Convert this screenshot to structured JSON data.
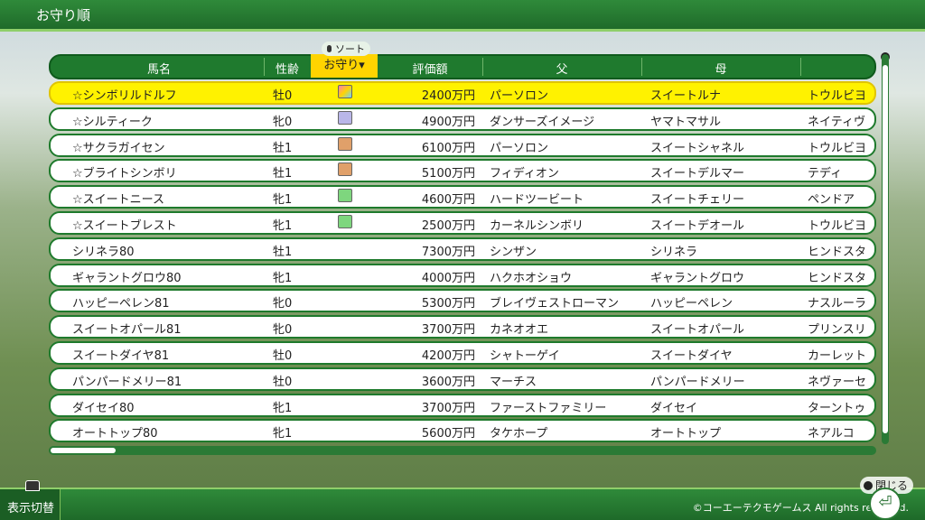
{
  "title": "お守り順",
  "sort_label": "ソート",
  "columns": {
    "name": "馬名",
    "sex_age": "性齢",
    "omamori": "お守り",
    "price": "評価額",
    "sire": "父",
    "dam": "母"
  },
  "rows": [
    {
      "name": "☆シンボリルドルフ",
      "sex": "牡0",
      "omamori": "rainbow",
      "price": "2400万円",
      "sire": "パーソロン",
      "dam": "スイートルナ",
      "bms": "トウルビヨ"
    },
    {
      "name": "☆シルティーク",
      "sex": "牝0",
      "omamori": "purple",
      "price": "4900万円",
      "sire": "ダンサーズイメージ",
      "dam": "ヤマトマサル",
      "bms": "ネイティヴ"
    },
    {
      "name": "☆サクラガイセン",
      "sex": "牡1",
      "omamori": "orange",
      "price": "6100万円",
      "sire": "パーソロン",
      "dam": "スイートシャネル",
      "bms": "トウルビヨ"
    },
    {
      "name": "☆ブライトシンボリ",
      "sex": "牡1",
      "omamori": "orange",
      "price": "5100万円",
      "sire": "フィディオン",
      "dam": "スイートデルマー",
      "bms": "テディ"
    },
    {
      "name": "☆スイートニース",
      "sex": "牝1",
      "omamori": "green",
      "price": "4600万円",
      "sire": "ハードツービート",
      "dam": "スイートチェリー",
      "bms": "ペンドア"
    },
    {
      "name": "☆スイートブレスト",
      "sex": "牝1",
      "omamori": "green",
      "price": "2500万円",
      "sire": "カーネルシンボリ",
      "dam": "スイートデオール",
      "bms": "トウルビヨ"
    },
    {
      "name": "シリネラ80",
      "sex": "牡1",
      "omamori": "",
      "price": "7300万円",
      "sire": "シンザン",
      "dam": "シリネラ",
      "bms": "ヒンドスタ"
    },
    {
      "name": "ギャラントグロウ80",
      "sex": "牝1",
      "omamori": "",
      "price": "4000万円",
      "sire": "ハクホオショウ",
      "dam": "ギャラントグロウ",
      "bms": "ヒンドスタ"
    },
    {
      "name": "ハッピーペレン81",
      "sex": "牝0",
      "omamori": "",
      "price": "5300万円",
      "sire": "ブレイヴェストローマン",
      "dam": "ハッピーペレン",
      "bms": "ナスルーラ"
    },
    {
      "name": "スイートオパール81",
      "sex": "牝0",
      "omamori": "",
      "price": "3700万円",
      "sire": "カネオオエ",
      "dam": "スイートオパール",
      "bms": "プリンスリ"
    },
    {
      "name": "スイートダイヤ81",
      "sex": "牡0",
      "omamori": "",
      "price": "4200万円",
      "sire": "シャトーゲイ",
      "dam": "スイートダイヤ",
      "bms": "カーレット"
    },
    {
      "name": "パンパードメリー81",
      "sex": "牡0",
      "omamori": "",
      "price": "3600万円",
      "sire": "マーチス",
      "dam": "パンパードメリー",
      "bms": "ネヴァーセ"
    },
    {
      "name": "ダイセイ80",
      "sex": "牝1",
      "omamori": "",
      "price": "3700万円",
      "sire": "ファーストファミリー",
      "dam": "ダイセイ",
      "bms": "ターントゥ"
    },
    {
      "name": "オートトップ80",
      "sex": "牝1",
      "omamori": "",
      "price": "5600万円",
      "sire": "タケホープ",
      "dam": "オートトップ",
      "bms": "ネアルコ"
    }
  ],
  "footer": {
    "display_toggle": "表示切替",
    "close": "閉じる",
    "copyright": "©コーエーテクモゲームス All rights reserved."
  },
  "colors": {
    "rainbow": "linear-gradient(135deg,#ff7ab8,#ffd400,#6fd3ff)",
    "purple": "#b9b6e8",
    "orange": "#e0a06a",
    "green": "#7ed67e"
  }
}
